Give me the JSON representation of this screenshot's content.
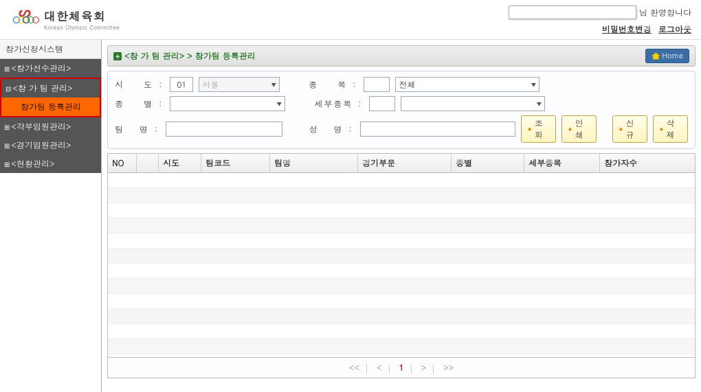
{
  "header": {
    "logo_ko": "대한체육회",
    "logo_en": "Korean Olympic Committee",
    "welcome_suffix": "님 환영합니다",
    "link_pwchange": "비밀번호변경",
    "link_logout": "로그아웃"
  },
  "sidebar": {
    "title": "참가신청시스템",
    "items": [
      {
        "label": "<참가선수관리>",
        "expanded": false
      },
      {
        "label": "<참 가 팀 관리>",
        "expanded": true,
        "selected": true,
        "children": [
          {
            "label": "참가팀 등록관리",
            "active": true
          }
        ]
      },
      {
        "label": "<각부임원관리>",
        "expanded": false
      },
      {
        "label": "<경기임원관리>",
        "expanded": false
      },
      {
        "label": "<현황관리>",
        "expanded": false
      }
    ]
  },
  "breadcrumb": {
    "icon": "+",
    "path1": "<참 가 팀 관리>",
    "sep": ">",
    "path2": "참가팀 등록관리",
    "home_label": "Home"
  },
  "filters": {
    "sido_label": "시 도",
    "sido_code": "01",
    "sido_name": "서울",
    "jongmok_label": "종 목",
    "jongmok_value": "전체",
    "jongbyeol_label": "종 별",
    "jongbyeol_value": "",
    "sebu_label": "세부종목",
    "sebu_value": "",
    "teamname_label": "팀 명",
    "teamname_value": "",
    "name_label": "성 명",
    "name_value": ""
  },
  "buttons": {
    "search": "조 회",
    "print": "인 쇄",
    "new": "신 규",
    "delete": "삭 제"
  },
  "grid": {
    "headers": {
      "no": "NO",
      "sido": "시도",
      "teamcode": "팀코드",
      "teamname": "팀명",
      "gamebumoon": "경기부문",
      "jongbyeol": "종별",
      "sebu": "세부종목",
      "count": "참가자수"
    },
    "rows": []
  },
  "pager": {
    "first": "<<",
    "prev": "<",
    "current": "1",
    "next": ">",
    "last": ">>"
  }
}
